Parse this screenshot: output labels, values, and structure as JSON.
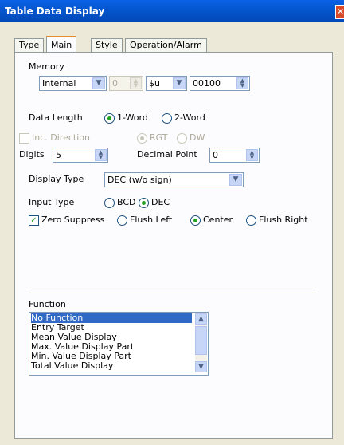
{
  "window": {
    "title": "Table Data Display"
  },
  "tabs": [
    {
      "label": "Type"
    },
    {
      "label": "Main"
    },
    {
      "label": "Style"
    },
    {
      "label": "Operation/Alarm"
    }
  ],
  "memory": {
    "label": "Memory",
    "area": "Internal",
    "index": "0",
    "type": "$u",
    "address": "00100"
  },
  "data_length": {
    "label": "Data Length",
    "opt1": "1-Word",
    "opt2": "2-Word",
    "selected": "1-Word"
  },
  "inc_direction": {
    "label": "Inc. Direction",
    "opt1": "RGT",
    "opt2": "DW"
  },
  "digits": {
    "label": "Digits",
    "value": "5"
  },
  "decimal_point": {
    "label": "Decimal Point",
    "value": "0"
  },
  "display_type": {
    "label": "Display Type",
    "value": "DEC (w/o sign)"
  },
  "input_type": {
    "label": "Input Type",
    "opt1": "BCD",
    "opt2": "DEC",
    "selected": "DEC"
  },
  "zero_suppress": {
    "label": "Zero Suppress",
    "checked": true
  },
  "alignment": {
    "opt1": "Flush Left",
    "opt2": "Center",
    "opt3": "Flush Right",
    "selected": "Center"
  },
  "function": {
    "label": "Function",
    "items": [
      "No Function",
      "Entry Target",
      "Mean Value Display",
      "Max. Value Display Part",
      "Min. Value Display Part",
      "Total Value Display"
    ],
    "selected": "No Function"
  }
}
